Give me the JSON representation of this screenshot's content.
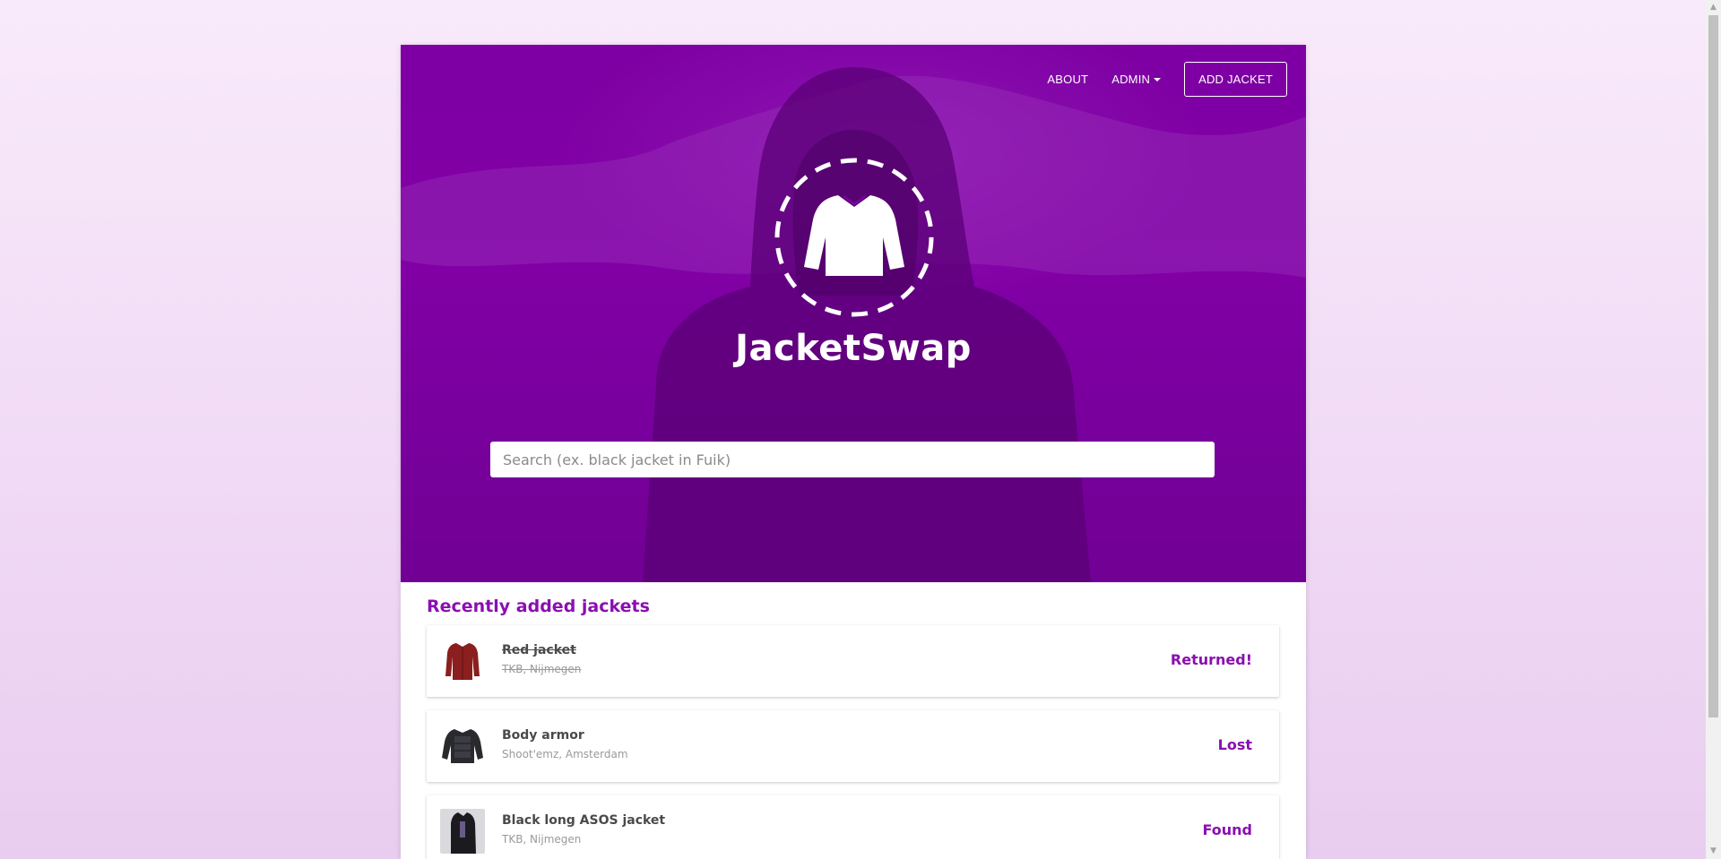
{
  "nav": {
    "about_label": "ABOUT",
    "admin_label": "ADMIN",
    "add_jacket_label": "ADD JACKET"
  },
  "hero": {
    "brand": "JacketSwap",
    "search_placeholder": "Search (ex. black jacket in Fuik)",
    "logo_icon": "jacket-icon"
  },
  "recent": {
    "title": "Recently added jackets",
    "items": [
      {
        "title": "Red jacket",
        "location": "TKB, Nijmegen",
        "status": "Returned!",
        "returned": true,
        "thumb_color": "#8b1e1e"
      },
      {
        "title": "Body armor",
        "location": "Shoot'emz, Amsterdam",
        "status": "Lost",
        "returned": false,
        "thumb_color": "#2a2a2e"
      },
      {
        "title": "Black long ASOS jacket",
        "location": "TKB, Nijmegen",
        "status": "Found",
        "returned": false,
        "thumb_color": "#1b1b1f"
      }
    ]
  },
  "colors": {
    "hero": "#8300a8",
    "accent": "#8a0fb0"
  }
}
